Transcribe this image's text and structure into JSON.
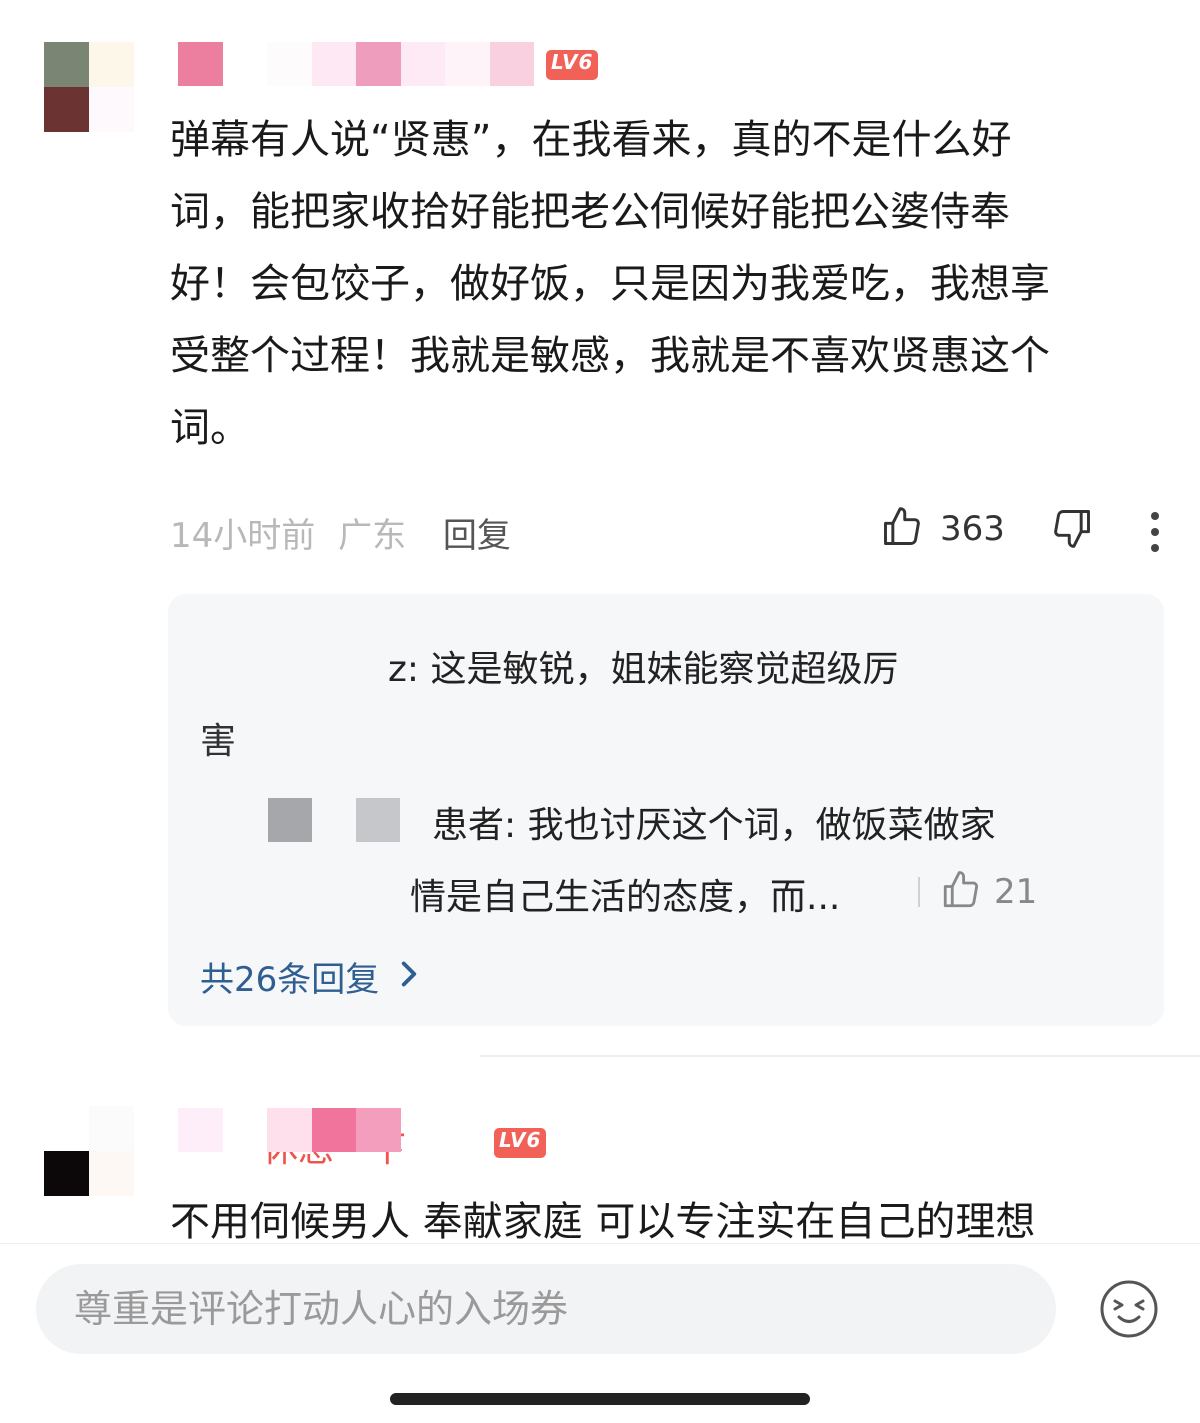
{
  "comment1": {
    "level_badge": "LV6",
    "text": "弹幕有人说“贤惠”，在我看来，真的不是什么好词，能把家收拾好能把老公伺候好能把公婆侍奉好！会包饺子，做好饭，只是因为我爱吃，我想享受整个过程！我就是敏感，我就是不喜欢贤惠这个词。",
    "text_lines": [
      "弹幕有人说“贤惠”，在我看来，真的不是什么好",
      "词，能把家收拾好能把老公伺候好能把公婆侍奉",
      "好！会包饺子，做好饭，只是因为我爱吃，我想享",
      "受整个过程！我就是敏感，我就是不喜欢贤惠这个",
      "词。"
    ],
    "time": "14小时前",
    "location": "广东",
    "reply_label": "回复",
    "like_count": "363"
  },
  "replies": {
    "reply1_line1": "z: 这是敏锐，姐妹能察觉超级厉",
    "reply1_line2": "害",
    "reply2_line1": "患者: 我也讨厌这个词，做饭菜做家",
    "reply2_line2": "情是自己生活的态度，而...",
    "reply2_like_count": "21",
    "total_replies_label": "共26条回复"
  },
  "comment2": {
    "name_tail": "休息一下",
    "level_badge": "LV6",
    "text": "不用伺候男人 奉献家庭 可以专注实在自己的理想"
  },
  "input": {
    "placeholder": "尊重是评论打动人心的入场券"
  },
  "colors": {
    "accent_red": "#f0544e",
    "link_blue": "#2f5e91",
    "panel_bg": "#f6f7f9",
    "meta_grey": "#b8b8b8"
  },
  "icons": [
    "thumbs-up-icon",
    "thumbs-down-icon",
    "more-vertical-icon",
    "chevron-right-icon",
    "emoji-icon"
  ]
}
